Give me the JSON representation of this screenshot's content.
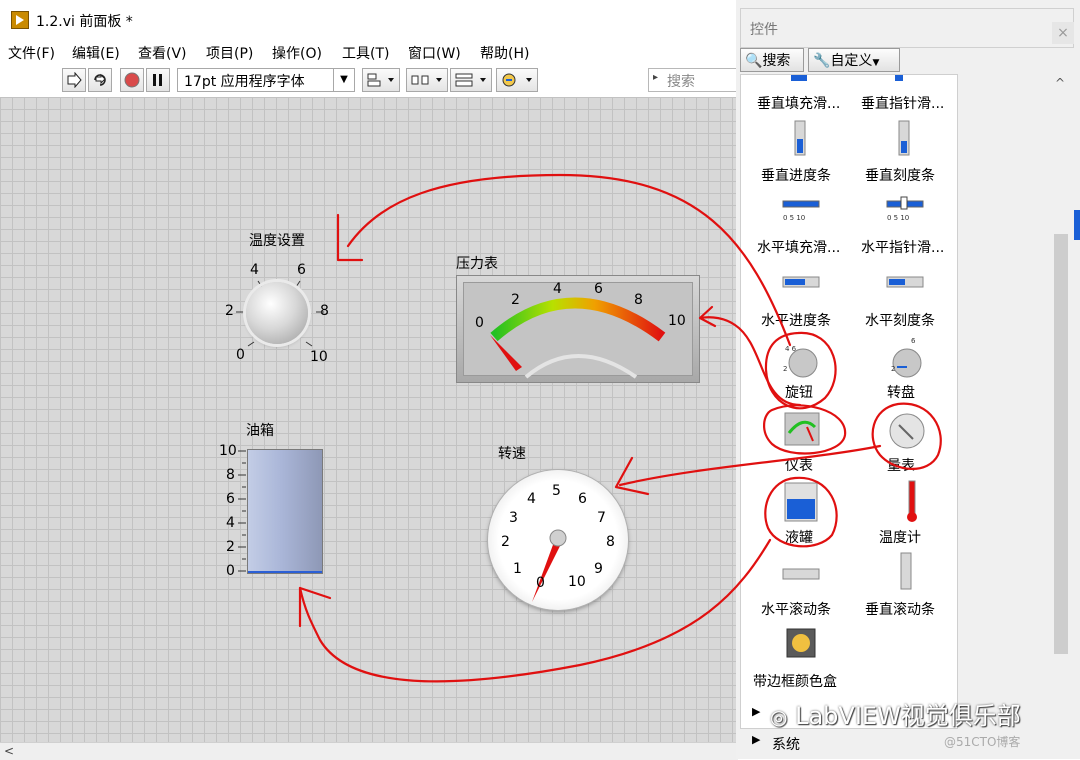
{
  "window": {
    "title": "1.2.vi 前面板 *"
  },
  "menu": [
    "文件(F)",
    "编辑(E)",
    "查看(V)",
    "项目(P)",
    "操作(O)",
    "工具(T)",
    "窗口(W)",
    "帮助(H)"
  ],
  "toolbar": {
    "font_label": "17pt 应用程序字体",
    "search_placeholder": "搜索"
  },
  "front_panel": {
    "knob": {
      "label": "温度设置",
      "ticks": [
        "4",
        "6",
        "2",
        "8",
        "0",
        "10"
      ]
    },
    "meter": {
      "label": "压力表",
      "ticks": [
        "0",
        "2",
        "4",
        "6",
        "8",
        "10"
      ]
    },
    "tank": {
      "label": "油箱",
      "ticks": [
        "10",
        "8",
        "6",
        "4",
        "2",
        "0"
      ]
    },
    "dial": {
      "label": "转速",
      "ticks": [
        "5",
        "4",
        "6",
        "3",
        "7",
        "2",
        "8",
        "1",
        "9",
        "0",
        "10"
      ]
    }
  },
  "palette": {
    "title": "控件",
    "search_button": "搜索",
    "customize_button": "自定义",
    "items": [
      "垂直填充滑...",
      "垂直指针滑...",
      "垂直进度条",
      "垂直刻度条",
      "水平填充滑...",
      "水平指针滑...",
      "水平进度条",
      "水平刻度条",
      "旋钮",
      "转盘",
      "仪表",
      "量表",
      "液罐",
      "温度计",
      "水平滚动条",
      "垂直滚动条",
      "带边框颜色盒"
    ],
    "categories": [
      "",
      "系统"
    ]
  },
  "watermark": {
    "main": "LabVIEW视觉俱乐部",
    "site": "@51CTO博客"
  },
  "colors": {
    "accent_red": "#e01010",
    "canvas_bg": "#d8d8d8",
    "tank_fill": "#aab6d8"
  }
}
